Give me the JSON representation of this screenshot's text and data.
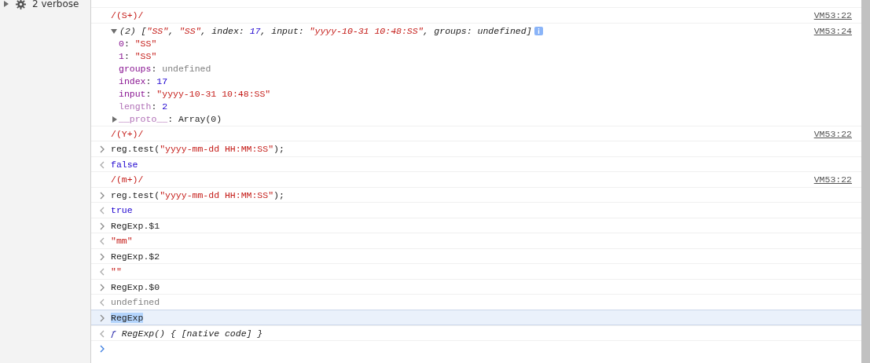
{
  "sidebar": {
    "items": [
      {
        "label": "2 verbose",
        "expanded": false
      }
    ]
  },
  "console": {
    "entries": [
      {
        "kind": "log",
        "selected": false,
        "tokens": [
          {
            "kind": "string",
            "text": "/(S+)/"
          }
        ],
        "source": "VM53:22"
      },
      {
        "kind": "object",
        "selected": false,
        "expanded": true,
        "source": "VM53:24",
        "tokens": [
          {
            "kind": "plain",
            "text": "(2) ["
          },
          {
            "kind": "string",
            "text": "\"SS\""
          },
          {
            "kind": "plain",
            "text": ", "
          },
          {
            "kind": "string",
            "text": "\"SS\""
          },
          {
            "kind": "plain",
            "text": ", index: "
          },
          {
            "kind": "number",
            "text": "17"
          },
          {
            "kind": "plain",
            "text": ", input: "
          },
          {
            "kind": "string",
            "text": "\"yyyy-10-31 10:48:SS\""
          },
          {
            "kind": "plain",
            "text": ", groups: undefined]"
          }
        ],
        "properties": [
          {
            "tokens": [
              {
                "kind": "key",
                "text": "0"
              },
              {
                "kind": "plain",
                "text": ": "
              },
              {
                "kind": "string",
                "text": "\"SS\""
              }
            ]
          },
          {
            "tokens": [
              {
                "kind": "key",
                "text": "1"
              },
              {
                "kind": "plain",
                "text": ": "
              },
              {
                "kind": "string",
                "text": "\"SS\""
              }
            ]
          },
          {
            "tokens": [
              {
                "kind": "key",
                "text": "groups"
              },
              {
                "kind": "plain",
                "text": ": "
              },
              {
                "kind": "undefined",
                "text": "undefined"
              }
            ]
          },
          {
            "tokens": [
              {
                "kind": "key",
                "text": "index"
              },
              {
                "kind": "plain",
                "text": ": "
              },
              {
                "kind": "number",
                "text": "17"
              }
            ]
          },
          {
            "tokens": [
              {
                "kind": "key",
                "text": "input"
              },
              {
                "kind": "plain",
                "text": ": "
              },
              {
                "kind": "string",
                "text": "\"yyyy-10-31 10:48:SS\""
              }
            ]
          },
          {
            "tokens": [
              {
                "kind": "dimkey",
                "text": "length"
              },
              {
                "kind": "plain",
                "text": ": "
              },
              {
                "kind": "number",
                "text": "2"
              }
            ]
          },
          {
            "expanded": false,
            "tokens": [
              {
                "kind": "dimkey",
                "text": "__proto__"
              },
              {
                "kind": "plain",
                "text": ": Array(0)"
              }
            ]
          }
        ]
      },
      {
        "kind": "log",
        "selected": false,
        "tokens": [
          {
            "kind": "string",
            "text": "/(Y+)/"
          }
        ],
        "source": "VM53:22"
      },
      {
        "kind": "input",
        "selected": false,
        "tokens": [
          {
            "kind": "plain",
            "text": "reg.test("
          },
          {
            "kind": "string",
            "text": "\"yyyy-mm-dd HH:MM:SS\""
          },
          {
            "kind": "plain",
            "text": ");"
          }
        ]
      },
      {
        "kind": "result",
        "selected": false,
        "tokens": [
          {
            "kind": "boolean",
            "text": "false"
          }
        ]
      },
      {
        "kind": "log",
        "selected": false,
        "tokens": [
          {
            "kind": "string",
            "text": "/(m+)/"
          }
        ],
        "source": "VM53:22"
      },
      {
        "kind": "input",
        "selected": false,
        "tokens": [
          {
            "kind": "plain",
            "text": "reg.test("
          },
          {
            "kind": "string",
            "text": "\"yyyy-mm-dd HH:MM:SS\""
          },
          {
            "kind": "plain",
            "text": ");"
          }
        ]
      },
      {
        "kind": "result",
        "selected": false,
        "tokens": [
          {
            "kind": "boolean",
            "text": "true"
          }
        ]
      },
      {
        "kind": "input",
        "selected": false,
        "tokens": [
          {
            "kind": "plain",
            "text": "RegExp.$1"
          }
        ]
      },
      {
        "kind": "result",
        "selected": false,
        "tokens": [
          {
            "kind": "string",
            "text": "\"mm\""
          }
        ]
      },
      {
        "kind": "input",
        "selected": false,
        "tokens": [
          {
            "kind": "plain",
            "text": "RegExp.$2"
          }
        ]
      },
      {
        "kind": "result",
        "selected": false,
        "tokens": [
          {
            "kind": "string",
            "text": "\"\""
          }
        ]
      },
      {
        "kind": "input",
        "selected": false,
        "tokens": [
          {
            "kind": "plain",
            "text": "RegExp.$0"
          }
        ]
      },
      {
        "kind": "result",
        "selected": false,
        "tokens": [
          {
            "kind": "undefined",
            "text": "undefined"
          }
        ]
      },
      {
        "kind": "input",
        "selected": true,
        "tokens": [
          {
            "kind": "highlighted",
            "text": "RegExp"
          }
        ]
      },
      {
        "kind": "function",
        "selected": false,
        "tokens": [
          {
            "kind": "keyword",
            "text": "ƒ"
          },
          {
            "kind": "plain",
            "text": " RegExp() { [native code] }"
          }
        ]
      },
      {
        "kind": "prompt",
        "selected": false
      }
    ]
  }
}
